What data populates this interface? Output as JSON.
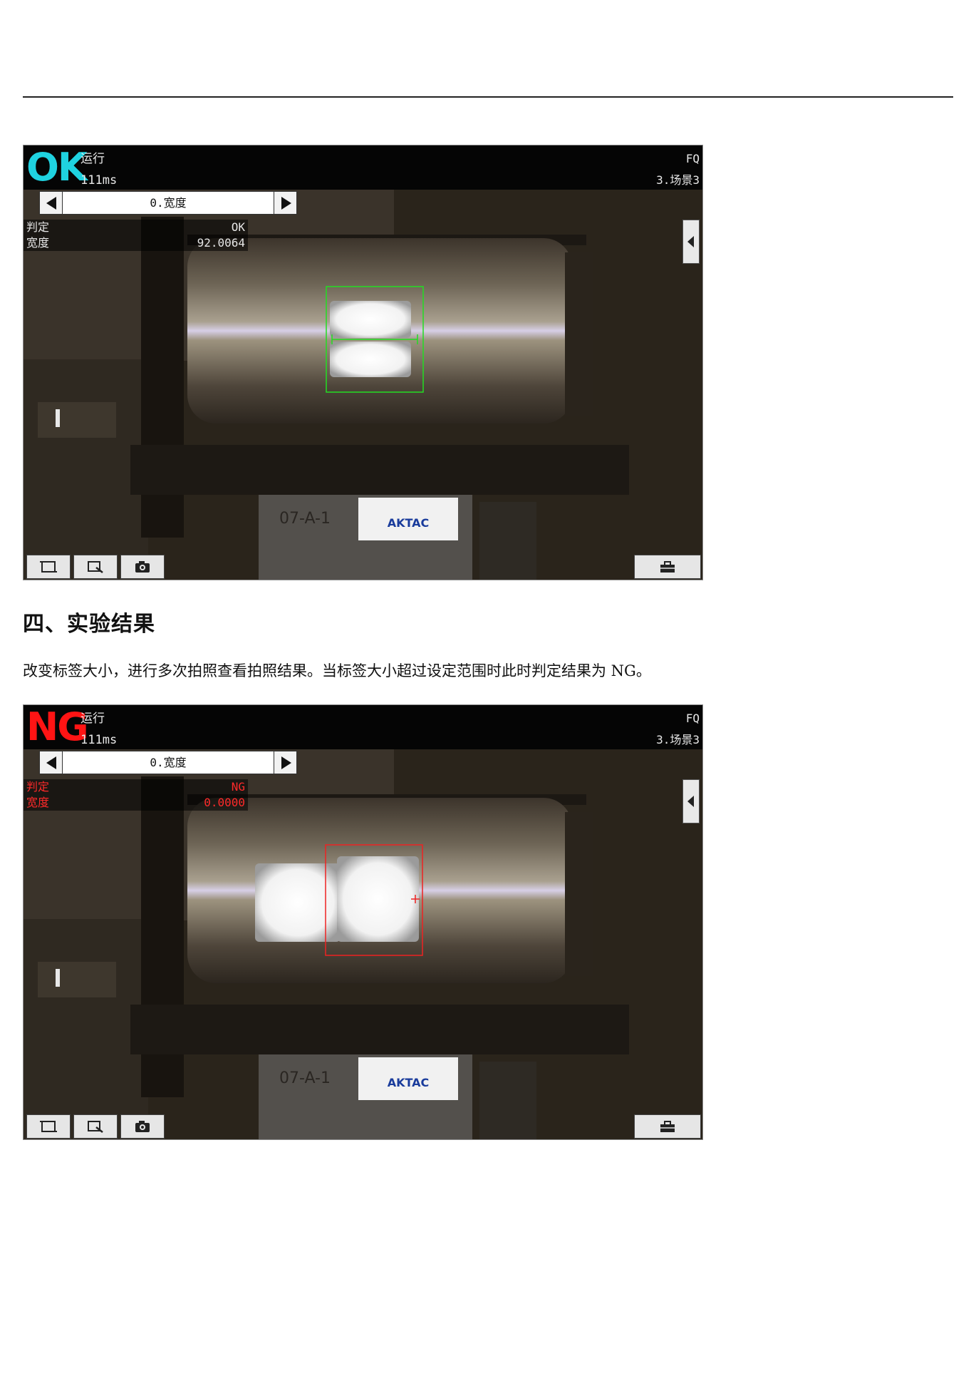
{
  "section": {
    "heading": "四、实验结果",
    "paragraph": "改变标签大小，进行多次拍照查看拍照结果。当标签大小超过设定范围时此时判定结果为 NG。"
  },
  "screen_ok": {
    "judge_badge": "OK",
    "mode": "运行",
    "time": "111ms",
    "corner_label": "FQ",
    "scene": "3.场景3",
    "item": "0.宽度",
    "result_rows": [
      {
        "label": "判定",
        "value": "OK"
      },
      {
        "label": "宽度",
        "value": "92.0064"
      }
    ],
    "box_color": "#22dd22"
  },
  "screen_ng": {
    "judge_badge": "NG",
    "mode": "运行",
    "time": "111ms",
    "corner_label": "FQ",
    "scene": "3.场景3",
    "item": "0.宽度",
    "result_rows": [
      {
        "label": "判定",
        "value": "NG"
      },
      {
        "label": "宽度",
        "value": "0.0000"
      }
    ],
    "box_color": "#ee2222"
  },
  "camera_label_text": "07-A-1",
  "sticker_text": "AKTAC",
  "icons": [
    "fit-frame-icon",
    "zoom-icon",
    "camera-icon",
    "toolbox-icon",
    "arrow-left-icon",
    "arrow-right-icon",
    "collapse-panel-icon"
  ]
}
